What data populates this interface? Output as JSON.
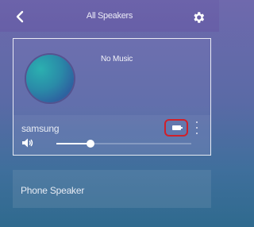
{
  "header": {
    "title": "All Speakers",
    "back_icon": "chevron-left-icon",
    "settings_icon": "gear-icon"
  },
  "speakers": [
    {
      "name": "samsung",
      "now_playing": "No Music",
      "volume_fraction": 0.25,
      "battery_icon": "battery-icon",
      "more_icon": "more-vertical-icon"
    }
  ],
  "phone_speaker": {
    "label": "Phone Speaker"
  },
  "colors": {
    "header_bg": "#675fa7",
    "highlight_border": "#d0202a",
    "text": "#ffffff"
  }
}
